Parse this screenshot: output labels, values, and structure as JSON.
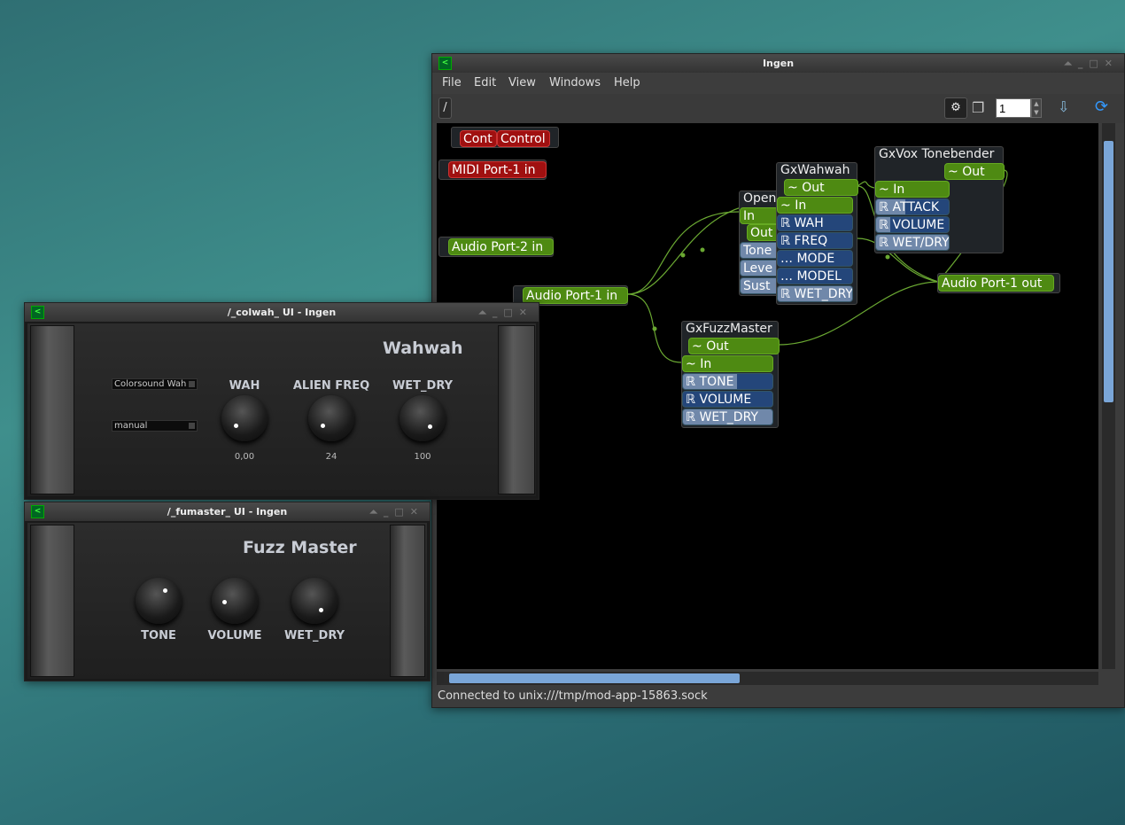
{
  "ingen": {
    "title": "Ingen",
    "menu": [
      "File",
      "Edit",
      "View",
      "Windows",
      "Help"
    ],
    "path_button": "/",
    "zoom_value": "1",
    "status": "Connected to unix:///tmp/mod-app-15863.sock"
  },
  "canvas": {
    "control_node": {
      "ports": [
        "Cont",
        "Control"
      ]
    },
    "midi_in": "MIDI Port-1 in",
    "audio_in2": "Audio Port-2 in",
    "audio_in1": "Audio Port-1 in",
    "audio_out1": "Audio Port-1 out",
    "open_node": {
      "title": "Open",
      "ports": [
        "In",
        "Out",
        "Tone",
        "Leve",
        "Sust"
      ]
    },
    "wahwah": {
      "title": "GxWahwah",
      "out": "Out",
      "in": "In",
      "controls": [
        {
          "label": "WAH",
          "fill": 0
        },
        {
          "label": "FREQ",
          "fill": 0
        },
        {
          "label": "MODE",
          "fill": 0
        },
        {
          "label": "MODEL",
          "fill": 0
        },
        {
          "label": "WET_DRY",
          "fill": 1
        }
      ]
    },
    "tonebender": {
      "title": "GxVox Tonebender",
      "out": "Out",
      "in": "In",
      "controls": [
        {
          "label": "ATTACK",
          "fill": 0.4
        },
        {
          "label": "VOLUME",
          "fill": 0.2
        },
        {
          "label": "WET/DRY",
          "fill": 1
        }
      ]
    },
    "fuzzmaster": {
      "title": "GxFuzzMaster",
      "out": "Out",
      "in": "In",
      "controls": [
        {
          "label": "TONE",
          "fill": 0.6
        },
        {
          "label": "VOLUME",
          "fill": 0
        },
        {
          "label": "WET_DRY",
          "fill": 1
        }
      ]
    }
  },
  "colwah": {
    "title": "/_colwah_ UI - Ingen",
    "plugin_name": "Wahwah",
    "model_select": "Colorsound Wah",
    "mode_select": "manual",
    "knobs": [
      {
        "label": "WAH",
        "value": "0,00"
      },
      {
        "label": "ALIEN FREQ",
        "value": "24"
      },
      {
        "label": "WET_DRY",
        "value": "100"
      }
    ]
  },
  "fumaster": {
    "title": "/_fumaster_ UI - Ingen",
    "plugin_name": "Fuzz Master",
    "knobs": [
      {
        "label": "TONE"
      },
      {
        "label": "VOLUME"
      },
      {
        "label": "WET_DRY"
      }
    ]
  },
  "colors": {
    "audio_port": "#4e8a12",
    "control_port": "#24467a",
    "midi_port": "#a01010",
    "wire": "#6aa832"
  }
}
